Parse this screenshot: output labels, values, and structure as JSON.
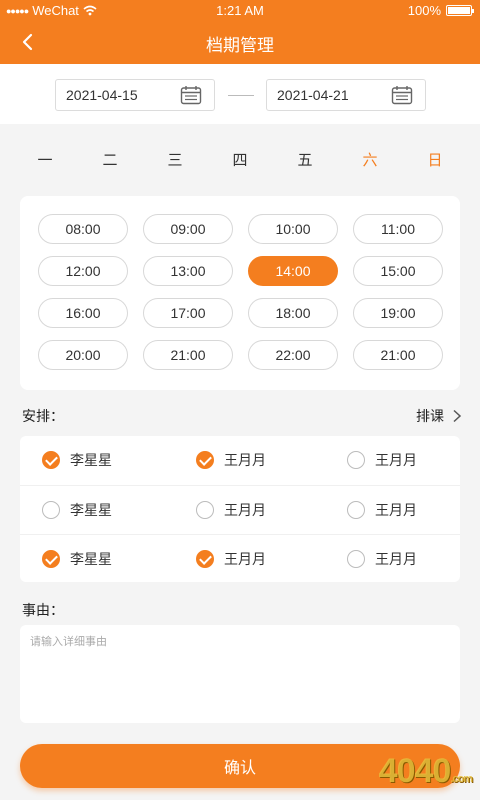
{
  "status_bar": {
    "carrier": "WeChat",
    "time": "1:21 AM",
    "battery": "100%"
  },
  "nav": {
    "title": "档期管理"
  },
  "date_range": {
    "start": "2021-04-15",
    "end": "2021-04-21"
  },
  "week": {
    "days": [
      "一",
      "二",
      "三",
      "四",
      "五",
      "六",
      "日"
    ],
    "selected_index": 0
  },
  "time_slots": {
    "items": [
      "08:00",
      "09:00",
      "10:00",
      "11:00",
      "12:00",
      "13:00",
      "14:00",
      "15:00",
      "16:00",
      "17:00",
      "18:00",
      "19:00",
      "20:00",
      "21:00",
      "22:00",
      "21:00"
    ],
    "selected_index": 6
  },
  "arrangement": {
    "label": "安排：",
    "schedule_link": "排课",
    "rows": [
      [
        {
          "name": "李星星",
          "checked": true
        },
        {
          "name": "王月月",
          "checked": true
        },
        {
          "name": "王月月",
          "checked": false
        }
      ],
      [
        {
          "name": "李星星",
          "checked": false
        },
        {
          "name": "王月月",
          "checked": false
        },
        {
          "name": "王月月",
          "checked": false
        }
      ],
      [
        {
          "name": "李星星",
          "checked": true
        },
        {
          "name": "王月月",
          "checked": true
        },
        {
          "name": "王月月",
          "checked": false
        }
      ]
    ]
  },
  "reason": {
    "label": "事由：",
    "placeholder": "请输入详细事由"
  },
  "confirm_label": "确认",
  "watermark": {
    "main": "4040",
    "suffix": ".com"
  },
  "colors": {
    "accent": "#f47e1f"
  }
}
